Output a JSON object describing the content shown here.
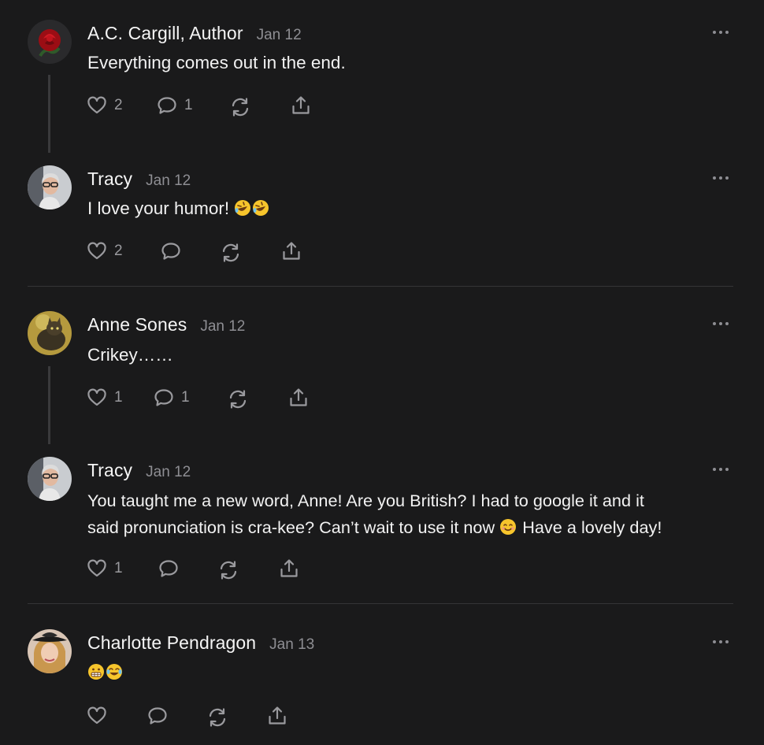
{
  "comments": [
    {
      "author": "A.C. Cargill, Author",
      "date": "Jan 12",
      "text": "Everything comes out in the end.",
      "likes": "2",
      "replies": "1"
    },
    {
      "author": "Tracy",
      "date": "Jan 12",
      "text": "I love your humor! ",
      "emoji": [
        "rolling-on-floor-laughing",
        "rolling-on-floor-laughing"
      ],
      "likes": "2",
      "replies": ""
    },
    {
      "author": "Anne Sones",
      "date": "Jan 12",
      "text": "Crikey……",
      "likes": "1",
      "replies": "1"
    },
    {
      "author": "Tracy",
      "date": "Jan 12",
      "text_line1": "You taught me a new word, Anne! Are you British? I had to google it and it",
      "text_line2a": "said pronunciation is cra-kee? Can’t wait to use it now ",
      "emoji": [
        "smiling-face"
      ],
      "text_line2b": " Have a lovely day!",
      "likes": "1",
      "replies": ""
    },
    {
      "author": "Charlotte Pendragon",
      "date": "Jan 13",
      "text": "",
      "emoji": [
        "grimacing-face",
        "face-with-tears-of-joy"
      ],
      "likes": "",
      "replies": ""
    }
  ],
  "icons": {
    "like": "heart-icon",
    "reply": "comment-bubble-icon",
    "restack": "restack-icon",
    "share": "share-icon",
    "more": "more-dots-icon"
  },
  "colors": {
    "background": "#1a1a1b",
    "muted": "#8e8e93",
    "text": "#f2f2f2",
    "divider": "#353537"
  }
}
